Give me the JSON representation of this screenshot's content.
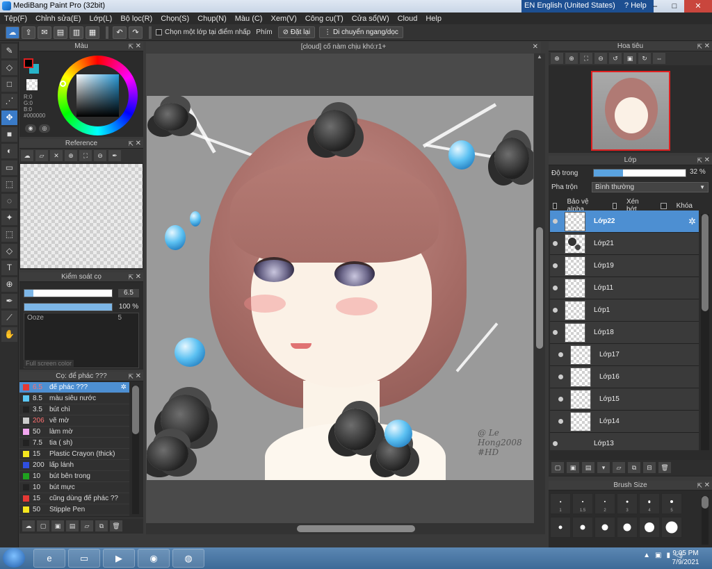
{
  "window": {
    "title": "MediBang Paint Pro (32bit)",
    "language": "EN English (United States)",
    "help": "Help"
  },
  "menu": [
    "Tệp(F)",
    "Chỉnh sửa(E)",
    "Lớp(L)",
    "Bộ lọc(R)",
    "Chọn(S)",
    "Chụp(N)",
    "Màu (C)",
    "Xem(V)",
    "Công cụ(T)",
    "Cửa sổ(W)",
    "Cloud",
    "Help"
  ],
  "toolbar": {
    "select_layer_label": "Chọn một lớp tại điểm nhấp",
    "key_label": "Phím",
    "reset_label": "Đặt lại",
    "move_label": "Di chuyển ngang/dọc"
  },
  "panels": {
    "color": {
      "title": "Màu",
      "rgb": [
        "R:0",
        "G:0",
        "B:0",
        "#000000"
      ],
      "fg_color": "#000000",
      "bg_color": "#27b3c8"
    },
    "reference": {
      "title": "Reference"
    },
    "brush_control": {
      "title": "Kiểm soát cọ",
      "size_value": "6.5",
      "size_fraction": 0.1,
      "opacity_value": "100 %",
      "opacity_fraction": 1.0,
      "list_item": "Ooze",
      "list_item_value": "5",
      "hint": "Full screen color"
    },
    "brushes": {
      "title": "Cọ: để phác ???",
      "items": [
        {
          "size": "6.5",
          "name": "để phác ???",
          "color": "#e53935",
          "selected": true,
          "red_size": true
        },
        {
          "size": "8.5",
          "name": "màu siêu nước",
          "color": "#5bc8f5"
        },
        {
          "size": "3.5",
          "name": "bút chì",
          "color": "#222222"
        },
        {
          "size": "206",
          "name": "vẽ mờ",
          "color": "#cccccc",
          "red_size": true
        },
        {
          "size": "50",
          "name": "làm mờ",
          "color": "#f3a6f0"
        },
        {
          "size": "7.5",
          "name": "tia ( sh)",
          "color": "#222222"
        },
        {
          "size": "15",
          "name": "Plastic Crayon (thick)",
          "color": "#f5e61e"
        },
        {
          "size": "200",
          "name": "lấp lánh",
          "color": "#2f4fe0"
        },
        {
          "size": "10",
          "name": "bút bên trong",
          "color": "#1fa21f"
        },
        {
          "size": "10",
          "name": "bút mực",
          "color": "#222222"
        },
        {
          "size": "15",
          "name": "cũng dùng để phác ??",
          "color": "#e53935"
        },
        {
          "size": "50",
          "name": "Stipple Pen",
          "color": "#f5e61e"
        }
      ]
    },
    "navigator": {
      "title": "Hoa tiêu"
    },
    "layer": {
      "title": "Lớp",
      "opacity_label": "Độ trong",
      "opacity_value": "32 %",
      "opacity_fraction": 0.32,
      "blend_label": "Pha trộn",
      "blend_value": "Bình thường",
      "protect_alpha": "Bảo vệ alpha",
      "clipping": "Xén bớt",
      "lock": "Khóa",
      "layers": [
        {
          "name": "Lớp22",
          "selected": true,
          "thumb": "blank"
        },
        {
          "name": "Lớp21",
          "thumb": "dark"
        },
        {
          "name": "Lớp19",
          "thumb": "blank"
        },
        {
          "name": "Lớp11",
          "thumb": "blank"
        },
        {
          "name": "Lớp1",
          "thumb": "blank"
        },
        {
          "name": "Lớp18",
          "thumb": "blank"
        },
        {
          "name": "Lớp17",
          "thumb": "blank",
          "indent": true
        },
        {
          "name": "Lớp16",
          "thumb": "blank",
          "indent": true
        },
        {
          "name": "Lớp15",
          "thumb": "blank",
          "indent": true
        },
        {
          "name": "Lớp14",
          "thumb": "blank",
          "indent": true
        },
        {
          "name": "Lớp13",
          "thumb": "face"
        }
      ]
    },
    "brush_size": {
      "title": "Brush Size",
      "sizes": [
        "1",
        "1.5",
        "2",
        "3",
        "4",
        "5"
      ]
    }
  },
  "document": {
    "tab_title": "[cloud] cố nàm chịu khó:r1+",
    "signature": [
      "@ Le",
      "Hong2008",
      "#HD"
    ]
  },
  "taskbar": {
    "time": "9:05 PM",
    "date": "7/9/2021"
  }
}
